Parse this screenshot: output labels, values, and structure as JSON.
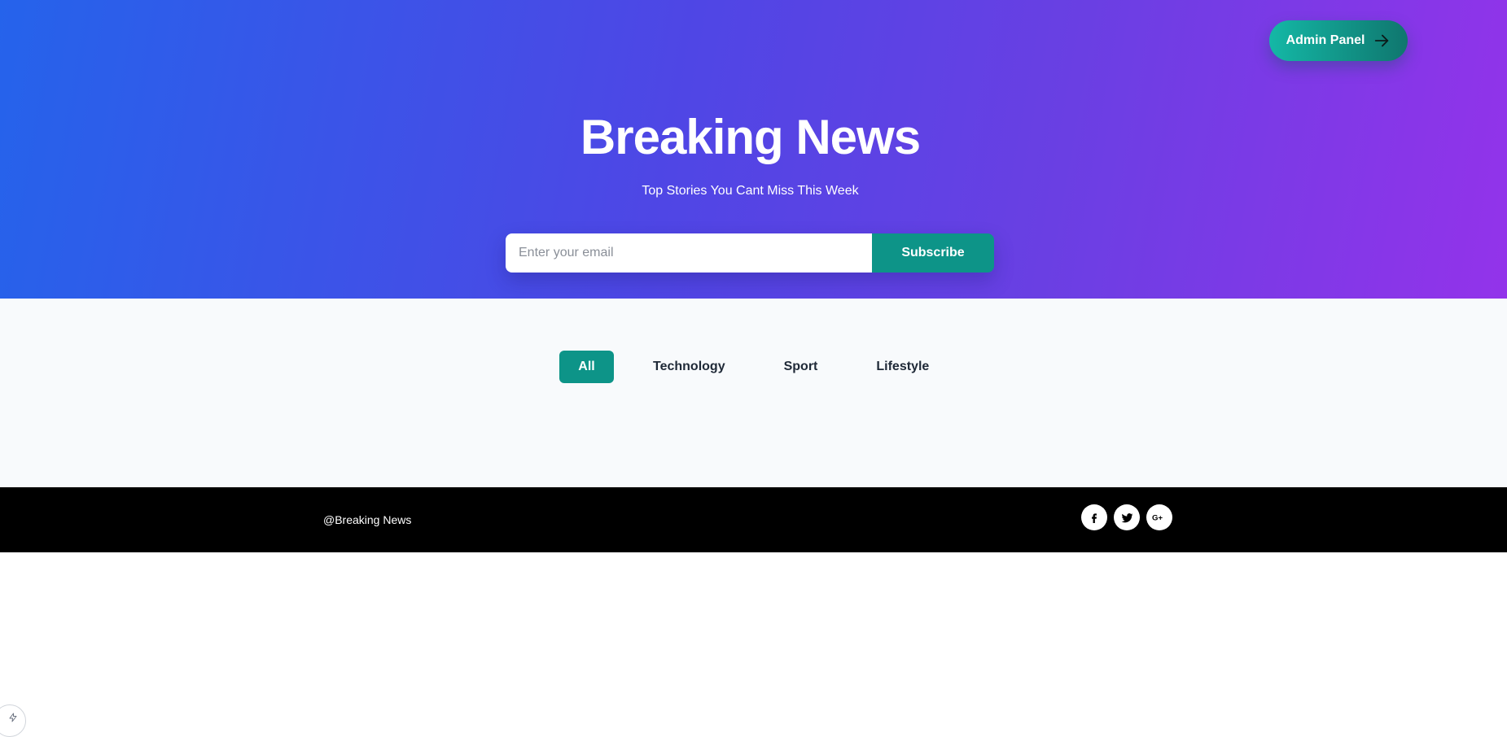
{
  "header": {
    "admin_button_label": "Admin Panel",
    "admin_icon": "arrow-right-icon",
    "title": "Breaking News",
    "subtitle": "Top Stories You Cant Miss This Week"
  },
  "subscribe": {
    "placeholder": "Enter your email",
    "value": "",
    "button_label": "Subscribe"
  },
  "filters": {
    "tabs": [
      {
        "label": "All",
        "active": true
      },
      {
        "label": "Technology",
        "active": false
      },
      {
        "label": "Sport",
        "active": false
      },
      {
        "label": "Lifestyle",
        "active": false
      }
    ]
  },
  "footer": {
    "brand": "@Breaking News",
    "social_icons": [
      "facebook-icon",
      "twitter-icon",
      "google-plus-icon"
    ]
  },
  "colors": {
    "gradient_start": "#2563eb",
    "gradient_end": "#9333ea",
    "accent_teal": "#0d9488",
    "footer_bg": "#000000",
    "content_bg": "#f8fafc"
  }
}
